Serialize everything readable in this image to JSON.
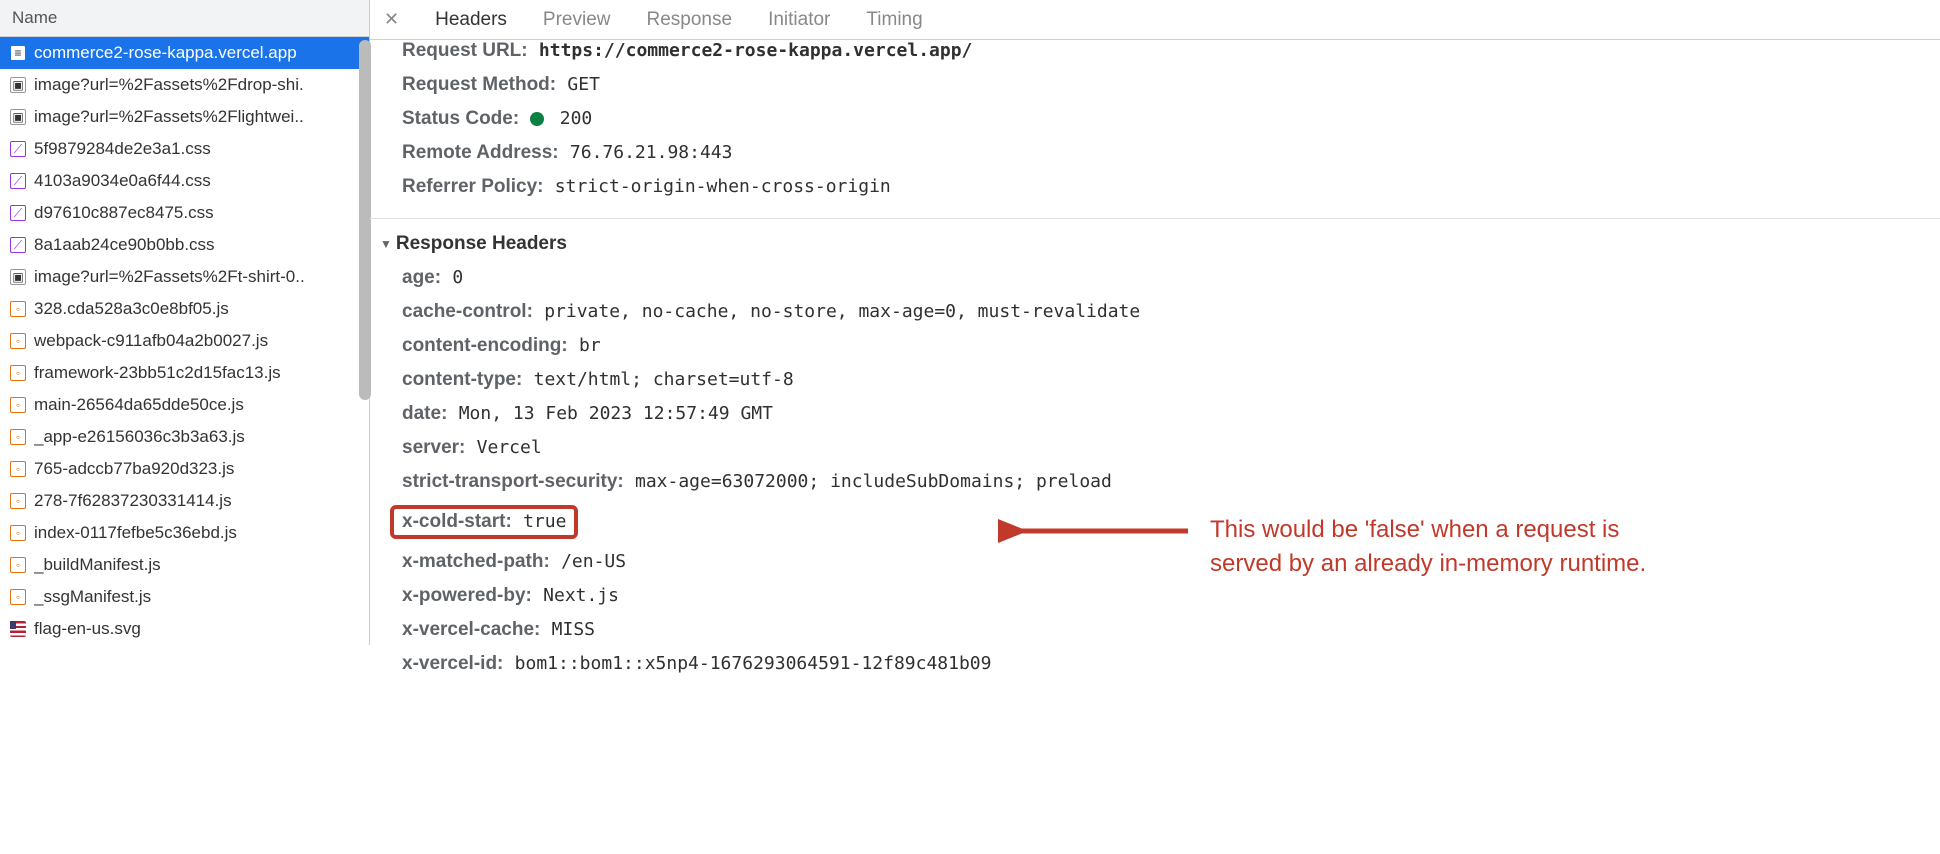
{
  "sidebar": {
    "header": "Name",
    "items": [
      {
        "icon": "doc",
        "label": "commerce2-rose-kappa.vercel.app",
        "selected": true
      },
      {
        "icon": "img",
        "label": "image?url=%2Fassets%2Fdrop-shi."
      },
      {
        "icon": "img",
        "label": "image?url=%2Fassets%2Flightwei.."
      },
      {
        "icon": "css",
        "label": "5f9879284de2e3a1.css"
      },
      {
        "icon": "css",
        "label": "4103a9034e0a6f44.css"
      },
      {
        "icon": "css",
        "label": "d97610c887ec8475.css"
      },
      {
        "icon": "css",
        "label": "8a1aab24ce90b0bb.css"
      },
      {
        "icon": "img",
        "label": "image?url=%2Fassets%2Ft-shirt-0.."
      },
      {
        "icon": "js",
        "label": "328.cda528a3c0e8bf05.js"
      },
      {
        "icon": "js",
        "label": "webpack-c911afb04a2b0027.js"
      },
      {
        "icon": "js",
        "label": "framework-23bb51c2d15fac13.js"
      },
      {
        "icon": "js",
        "label": "main-26564da65dde50ce.js"
      },
      {
        "icon": "js",
        "label": "_app-e26156036c3b3a63.js"
      },
      {
        "icon": "js",
        "label": "765-adccb77ba920d323.js"
      },
      {
        "icon": "js",
        "label": "278-7f62837230331414.js"
      },
      {
        "icon": "js",
        "label": "index-0117fefbe5c36ebd.js"
      },
      {
        "icon": "js",
        "label": "_buildManifest.js"
      },
      {
        "icon": "js",
        "label": "_ssgManifest.js"
      },
      {
        "icon": "svg-flag",
        "label": "flag-en-us.svg"
      }
    ]
  },
  "tabs": {
    "close": "✕",
    "items": [
      "Headers",
      "Preview",
      "Response",
      "Initiator",
      "Timing"
    ],
    "active": 0
  },
  "general": {
    "request_url_label": "Request URL:",
    "request_url_value": "https://commerce2-rose-kappa.vercel.app/",
    "request_method_label": "Request Method:",
    "request_method_value": "GET",
    "status_code_label": "Status Code:",
    "status_code_value": "200",
    "remote_address_label": "Remote Address:",
    "remote_address_value": "76.76.21.98:443",
    "referrer_policy_label": "Referrer Policy:",
    "referrer_policy_value": "strict-origin-when-cross-origin"
  },
  "response_section_title": "Response Headers",
  "response_headers": [
    {
      "label": "age:",
      "value": "0"
    },
    {
      "label": "cache-control:",
      "value": "private, no-cache, no-store, max-age=0, must-revalidate"
    },
    {
      "label": "content-encoding:",
      "value": "br"
    },
    {
      "label": "content-type:",
      "value": "text/html; charset=utf-8"
    },
    {
      "label": "date:",
      "value": "Mon, 13 Feb 2023 12:57:49 GMT"
    },
    {
      "label": "server:",
      "value": "Vercel"
    },
    {
      "label": "strict-transport-security:",
      "value": "max-age=63072000; includeSubDomains; preload"
    },
    {
      "label": "x-cold-start:",
      "value": "true",
      "highlight": true
    },
    {
      "label": "x-matched-path:",
      "value": "/en-US"
    },
    {
      "label": "x-powered-by:",
      "value": "Next.js"
    },
    {
      "label": "x-vercel-cache:",
      "value": "MISS"
    },
    {
      "label": "x-vercel-id:",
      "value": "bom1::bom1::x5np4-1676293064591-12f89c481b09"
    }
  ],
  "annotation": {
    "line1": "This would be 'false' when a request is",
    "line2": "served by an already in-memory runtime."
  }
}
